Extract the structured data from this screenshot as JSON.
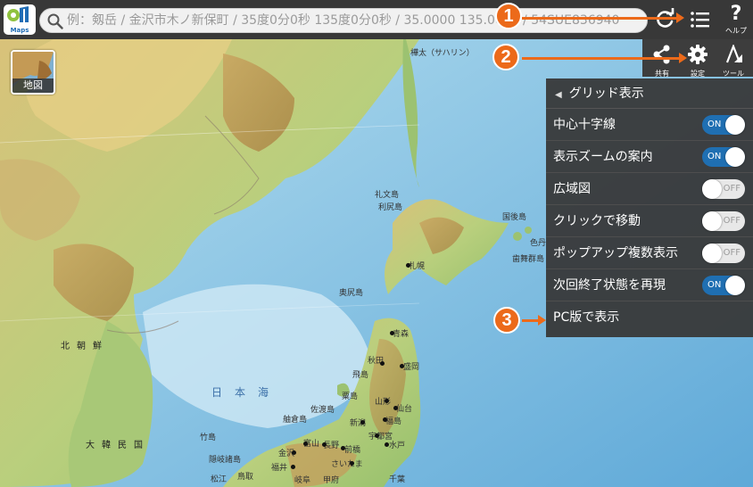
{
  "app": {
    "logo_text": "Maps"
  },
  "search": {
    "placeholder": "例：剱岳 / 金沢市木ノ新保町 / 35度0分0秒 135度0分0秒 / 35.0000 135.0000 / 54SUE836940"
  },
  "toolbar": {
    "help_label": "ヘルプ",
    "share_label": "共有",
    "settings_label": "設定",
    "tools_label": "ツール"
  },
  "layer_button": {
    "label": "地図"
  },
  "panel": {
    "title": "グリッド表示",
    "items": [
      {
        "label": "中心十字線",
        "toggle": "ON"
      },
      {
        "label": "表示ズームの案内",
        "toggle": "ON"
      },
      {
        "label": "広域図",
        "toggle": "OFF"
      },
      {
        "label": "クリックで移動",
        "toggle": "OFF"
      },
      {
        "label": "ポップアップ複数表示",
        "toggle": "OFF"
      },
      {
        "label": "次回終了状態を再現",
        "toggle": "ON"
      },
      {
        "label": "PC版で表示"
      }
    ]
  },
  "callouts": [
    "1",
    "2",
    "3"
  ],
  "map_labels": {
    "sakhalin": "樺太（サハリン）",
    "rebun": "礼文島",
    "rishiri": "利尻島",
    "kunashiri": "国後島",
    "shikotan": "色丹",
    "habomai": "歯舞群島",
    "sapporo": "札幌",
    "okushiri": "奥尻島",
    "aomori": "青森",
    "akita": "秋田",
    "morioka": "盛岡",
    "tobishima": "飛島",
    "yamagata": "山形",
    "sendai": "仙台",
    "awashima": "粟島",
    "sadoga": "佐渡島",
    "fukushima": "福島",
    "niigata": "新潟",
    "mito": "水戸",
    "utsunomiya": "宇都宮",
    "maebashi": "前橋",
    "saitama": "さいたま",
    "nagano": "長野",
    "toyama": "富山",
    "kanazawa": "金沢",
    "fukui": "福井",
    "gifu": "岐阜",
    "kofu": "甲府",
    "chiba": "千葉",
    "matsue": "松江",
    "tottori": "鳥取",
    "oki": "隠岐諸島",
    "takeshima": "竹島",
    "wajima_isl": "舳倉島",
    "nihonkai": "日本海",
    "north_korea": "北朝鮮",
    "south_korea": "大韓民国"
  },
  "colors": {
    "accent_orange": "#ec6a1a",
    "toggle_on": "#1f6fb2",
    "panel_bg": "#373737",
    "sea": "#9fd0e8"
  }
}
